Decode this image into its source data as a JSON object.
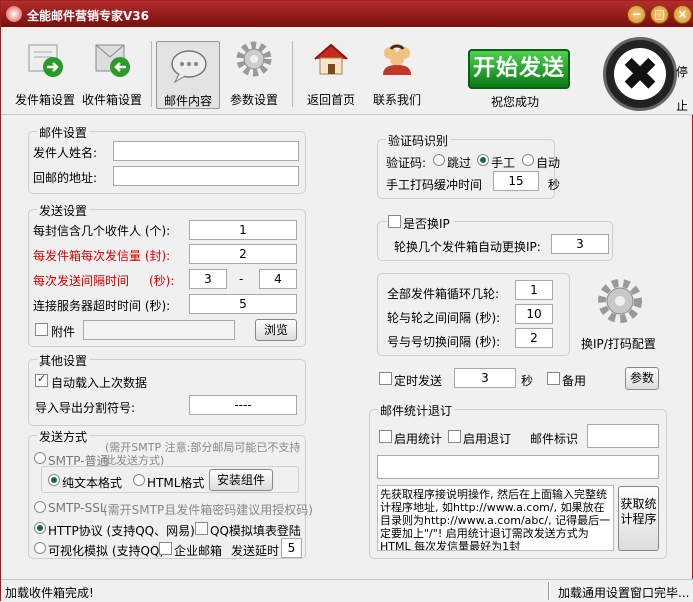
{
  "window": {
    "title": "全能邮件营销专家V36"
  },
  "toolbar": {
    "outbox": "发件箱设置",
    "inbox": "收件箱设置",
    "content": "邮件内容",
    "params": "参数设置",
    "home": "返回首页",
    "contact": "联系我们",
    "start": "开始发送",
    "status": "祝您成功",
    "stop": "停止"
  },
  "mail_settings": {
    "title": "邮件设置",
    "sender_name_label": "发件人姓名:",
    "reply_label": "回邮的地址:",
    "sender_name": "",
    "reply_addr": ""
  },
  "send_settings": {
    "title": "发送设置",
    "recv_per_mail_label": "每封信含几个收件人 (个):",
    "recv_per_mail": "1",
    "per_box_label": "每发件箱每次发信量 (封):",
    "per_box": "2",
    "interval_label": "每次发送间隔时间",
    "interval_unit": "(秒):",
    "interval_min": "3",
    "interval_dash": "-",
    "interval_max": "4",
    "timeout_label": "连接服务器超时时间 (秒):",
    "timeout": "5",
    "attach_label": "附件",
    "attach_value": "",
    "browse": "浏览"
  },
  "other": {
    "title": "其他设置",
    "autoload_label": "自动载入上次数据",
    "separator_label": "导入导出分割符号:",
    "separator": "----"
  },
  "send_mode": {
    "title": "发送方式",
    "smtp_normal": "SMTP-普通",
    "smtp_note": "(需开SMTP 注意:部分邮局可能已不支持此发送方式)",
    "plain": "纯文本格式",
    "html": "HTML格式",
    "install": "安装组件",
    "smtp_ssl": "SMTP-SSL",
    "smtp_ssl_note": "(需开SMTP且发件箱密码建议用授权码)",
    "http": "HTTP协议 (支持QQ、网易)",
    "qqsim": "QQ模拟填表登陆",
    "visual": "可视化模拟 (支持QQ)",
    "enterprise": "企业邮箱",
    "delay_label": "发送延时",
    "delay": "5"
  },
  "captcha": {
    "title": "验证码识别",
    "label": "验证码:",
    "skip": "跳过",
    "manual": "手工",
    "auto": "自动",
    "buffer_label": "手工打码缓冲时间",
    "buffer": "15",
    "sec": "秒"
  },
  "ip": {
    "switch_label": "是否换IP",
    "rotate_label": "轮换几个发件箱自动更换IP:",
    "rotate": "3"
  },
  "loop": {
    "loops_label": "全部发件箱循环几轮:",
    "loops": "1",
    "round_interval_label": "轮与轮之间间隔 (秒):",
    "round_interval": "10",
    "switch_interval_label": "号与号切换间隔 (秒):",
    "switch_interval": "2",
    "gear_label": "换IP/打码配置"
  },
  "timer": {
    "label": "定时发送",
    "value": "3",
    "unit": "秒",
    "backup": "备用",
    "params": "参数"
  },
  "stats": {
    "title": "邮件统计退订",
    "enable_stats": "启用统计",
    "enable_unsub": "启用退订",
    "tag_label": "邮件标识",
    "tag": "",
    "url": "",
    "note": "先获取程序接说明操作, 然后在上面输入完整统计程序地址, 如http://www.a.com/, 如果放在目录则为http://www.a.com/abc/, 记得最后一定要加上\"/\"! 启用统计退订需改发送方式为HTML 每次发信量最好为1封",
    "get_btn": "获取统计程序"
  },
  "status": {
    "left": "加载收件箱完成!",
    "right": "加载通用设置窗口完毕..."
  }
}
